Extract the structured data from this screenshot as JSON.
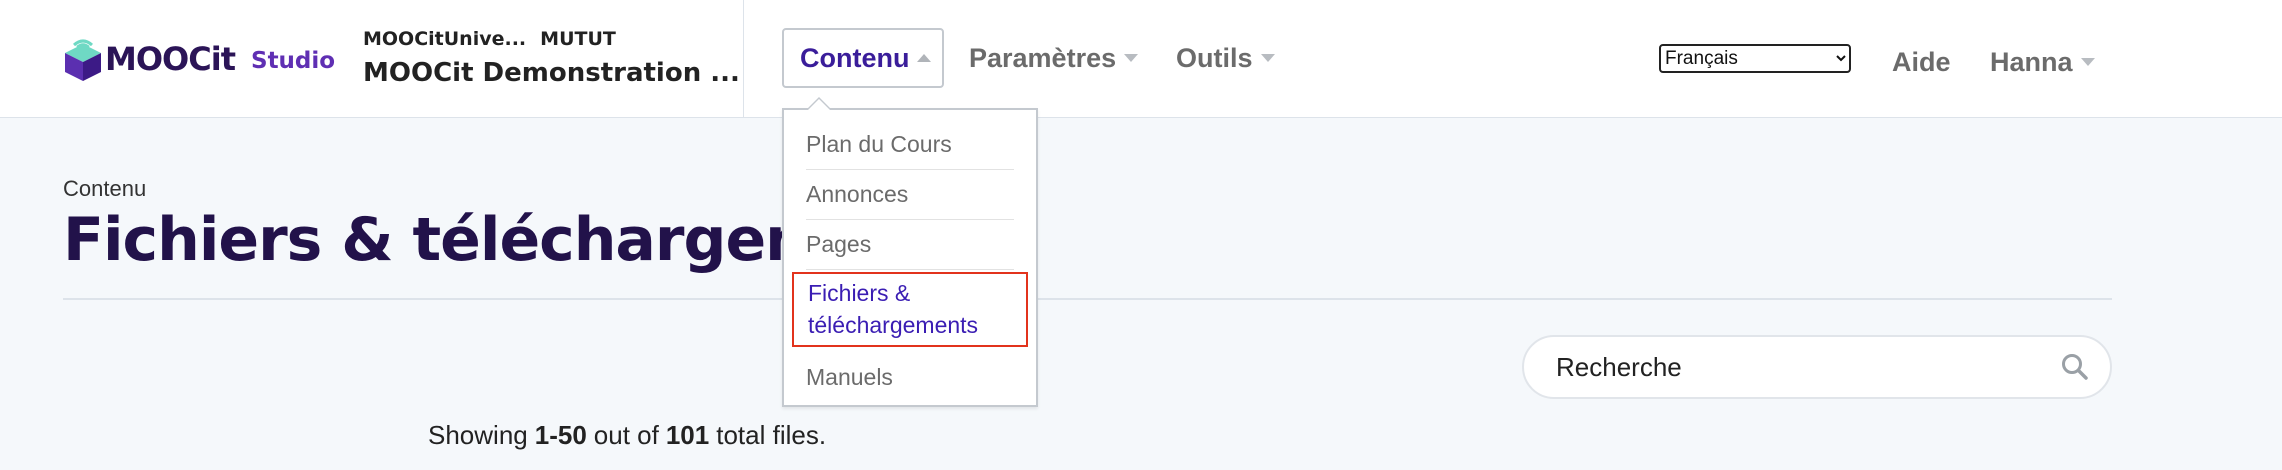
{
  "header": {
    "logo_text": "MOOCit",
    "logo_suffix": "Studio",
    "course_org": "MOOCitUnive...",
    "course_number": "MUTUT",
    "course_title": "MOOCit Demonstration ...",
    "nav": {
      "content": "Contenu",
      "settings": "Paramètres",
      "tools": "Outils"
    },
    "language": {
      "selected": "Français"
    },
    "help": "Aide",
    "user": "Hanna"
  },
  "dropdown": {
    "items": [
      {
        "label": "Plan du Cours"
      },
      {
        "label": "Annonces"
      },
      {
        "label": "Pages"
      },
      {
        "label": "Fichiers & téléchargements",
        "active": true
      },
      {
        "label": "Manuels"
      }
    ]
  },
  "page": {
    "breadcrumb": "Contenu",
    "title": "Fichiers & téléchargements"
  },
  "search": {
    "placeholder": "Recherche"
  },
  "pagination": {
    "prefix": "Showing",
    "range": "1-50",
    "middle": "out of",
    "total": "101",
    "suffix": "total files."
  },
  "colors": {
    "brand_dark": "#22124a",
    "brand_purple": "#5f2fb3",
    "active_nav": "#3a1d9a",
    "highlight_border": "#e2331c",
    "page_background": "#f5f8fb"
  },
  "icons": {
    "logo": "moocit-cube-icon",
    "search": "search-icon",
    "caret_up": "caret-up-icon",
    "caret_down": "caret-down-icon"
  }
}
